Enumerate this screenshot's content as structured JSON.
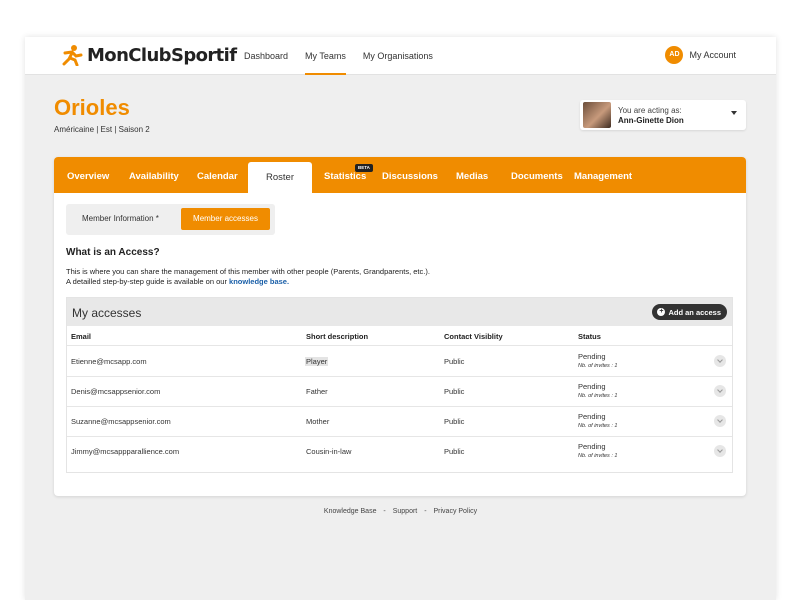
{
  "brand": {
    "name": "MonClubSportif",
    "accent": "#f08c00"
  },
  "nav": {
    "items": [
      {
        "label": "Dashboard"
      },
      {
        "label": "My Teams"
      },
      {
        "label": "My Organisations"
      }
    ],
    "active": "My Teams"
  },
  "account": {
    "initials": "AD",
    "label": "My Account"
  },
  "team": {
    "name": "Orioles",
    "subtitle": "Américaine | Est | Saison 2"
  },
  "acting": {
    "line1": "You are acting as:",
    "name": "Ann-Ginette Dion"
  },
  "tabs": [
    {
      "label": "Overview"
    },
    {
      "label": "Availability"
    },
    {
      "label": "Calendar"
    },
    {
      "label": "Roster"
    },
    {
      "label": "Statistics"
    },
    {
      "label": "Discussions"
    },
    {
      "label": "Medias"
    },
    {
      "label": "Documents"
    },
    {
      "label": "Management"
    }
  ],
  "beta_badge": "BETA",
  "subtabs": {
    "member_info": "Member Information *",
    "member_accesses": "Member accesses"
  },
  "info": {
    "title": "What is an Access?",
    "p1": "This is where you can share the management of this member with other people (Parents, Grandparents, etc.).",
    "p2_prefix": "A detailled step-by-step guide is available on our",
    "p2_link": "knowledge base."
  },
  "accesses": {
    "title": "My accesses",
    "add_label": "Add an access",
    "columns": {
      "email": "Email",
      "short_description": "Short description",
      "contact": "Contact Visiblity",
      "status": "Status"
    },
    "rows": [
      {
        "email": "Etienne@mcsapp.com",
        "desc": "Player",
        "contact": "Public",
        "status": "Pending",
        "invites": "Nb. of invites : 1"
      },
      {
        "email": "Denis@mcsappsenior.com",
        "desc": "Father",
        "contact": "Public",
        "status": "Pending",
        "invites": "Nb. of invites : 1"
      },
      {
        "email": "Suzanne@mcsappsenior.com",
        "desc": "Mother",
        "contact": "Public",
        "status": "Pending",
        "invites": "Nb. of invites : 1"
      },
      {
        "email": "Jimmy@mcsappparallience.com",
        "desc": "Cousin-in-law",
        "contact": "Public",
        "status": "Pending",
        "invites": "Nb. of invites : 1"
      }
    ]
  },
  "footer": {
    "links": [
      "Knowledge Base",
      "Support",
      "Privacy Policy"
    ],
    "separator": "-"
  }
}
